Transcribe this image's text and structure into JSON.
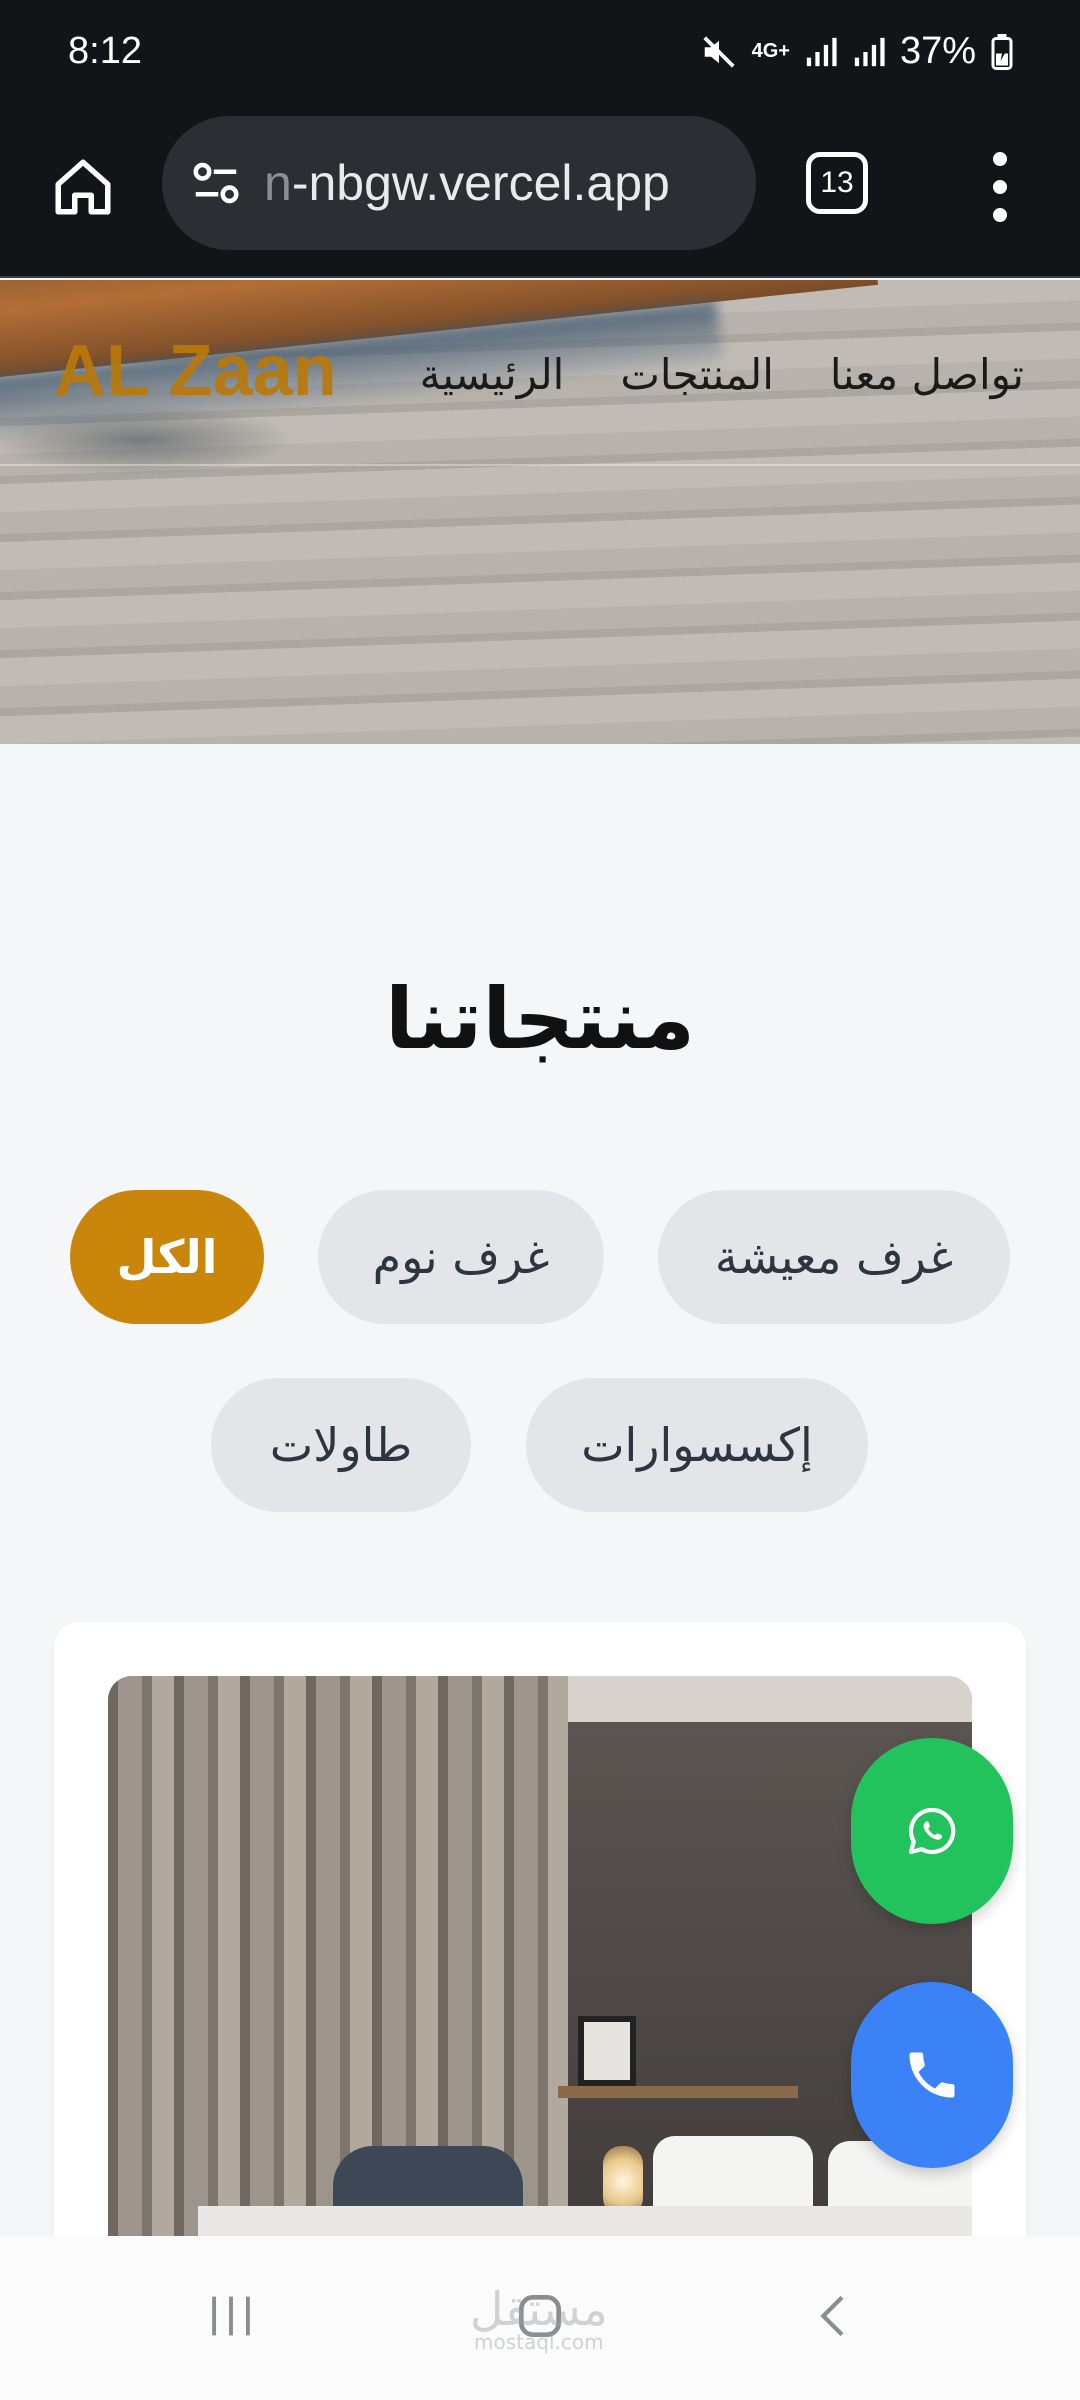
{
  "status_bar": {
    "time": "8:12",
    "network": "4G+",
    "battery": "37%",
    "icons": [
      "mute-icon",
      "signal-icon",
      "signal-icon",
      "battery-charging-icon"
    ]
  },
  "browser": {
    "url_faded": "n",
    "url_main": "-nbgw.vercel.app",
    "tab_count": "13",
    "icons": [
      "home-icon",
      "site-settings-icon",
      "more-vert-icon"
    ]
  },
  "site": {
    "brand": "AL Zaan",
    "brand_color": "#b9790b",
    "nav": {
      "home": "الرئيسية",
      "products": "المنتجات",
      "contact": "تواصل معنا"
    }
  },
  "products": {
    "title": "منتجاتنا",
    "filters": {
      "all": "الكل",
      "bedrooms": "غرف نوم",
      "living_rooms": "غرف معيشة",
      "tables": "طاولات",
      "accessories": "إكسسوارات"
    },
    "active_filter": "الكل",
    "active_color": "#c9860b"
  },
  "fabs": {
    "whatsapp_color": "#22c35d",
    "phone_color": "#3b82f6",
    "icons": [
      "whatsapp-icon",
      "phone-icon"
    ]
  },
  "android_nav": {
    "icons": [
      "recent-apps-icon",
      "home-icon",
      "back-icon"
    ],
    "watermark": "مستقل",
    "watermark_sub": "mostaql.com"
  }
}
